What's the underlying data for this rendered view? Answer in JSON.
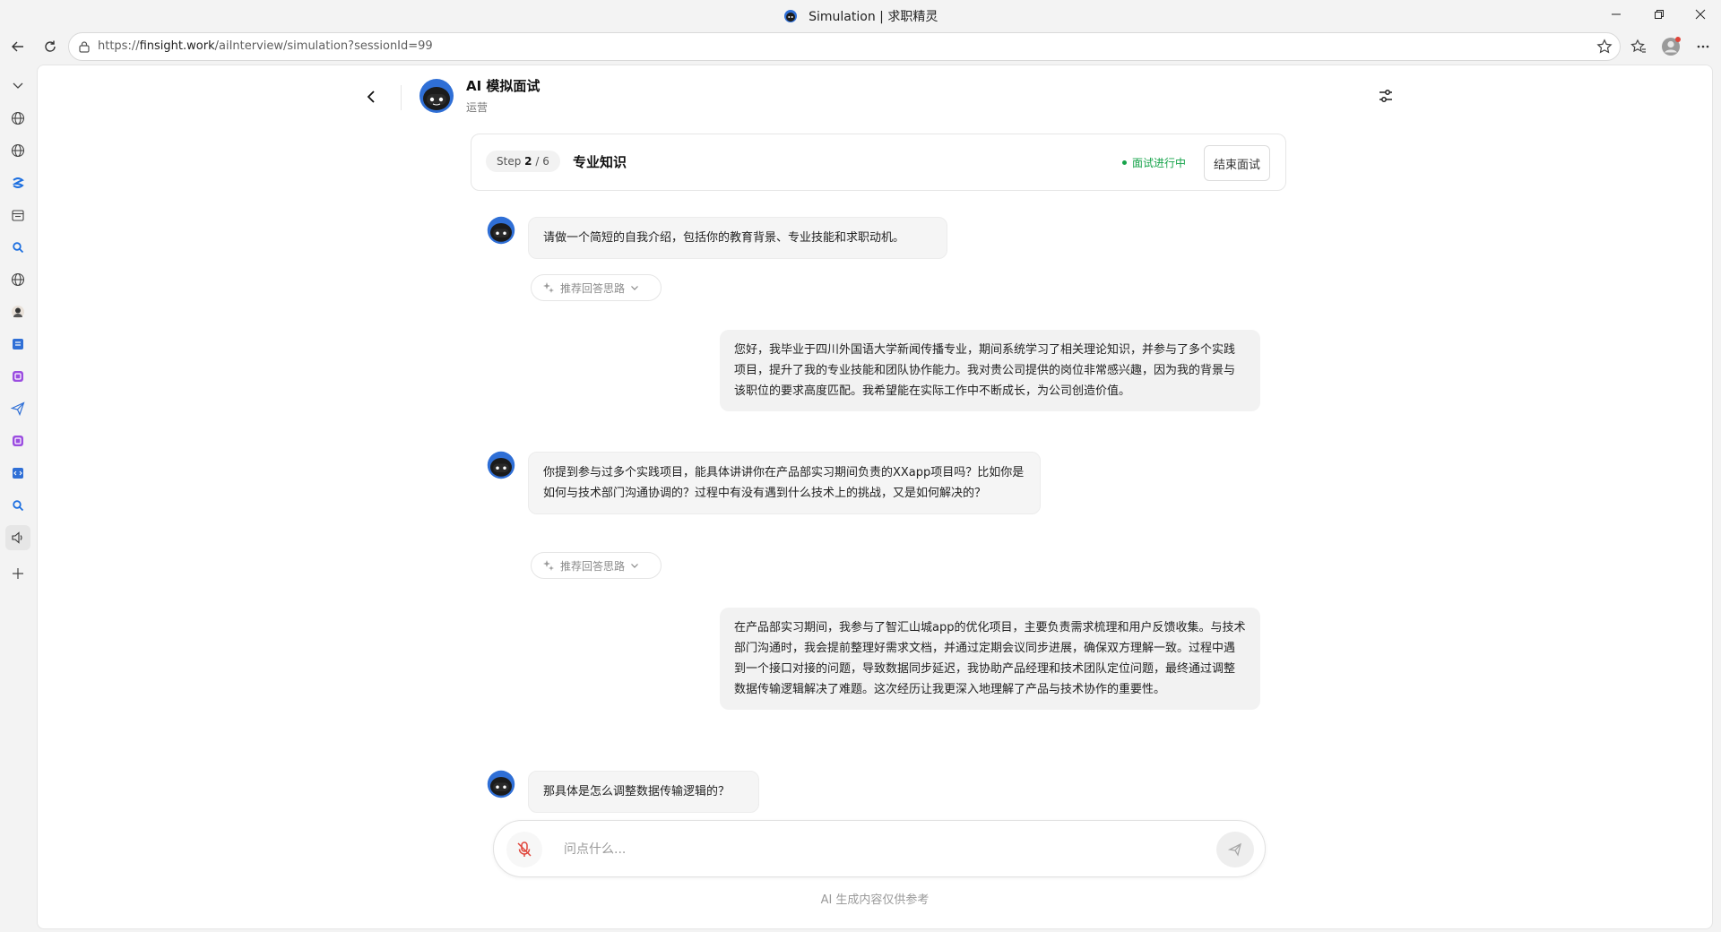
{
  "window": {
    "title": "Simulation | 求职精灵"
  },
  "browser": {
    "url_prefix": "https://",
    "url_host": "finsight.work",
    "url_path": "/aiInterview/simulation?sessionId=99"
  },
  "header": {
    "title": "AI 模拟面试",
    "subtitle": "运营"
  },
  "step": {
    "label": "Step",
    "current": "2",
    "total": "/ 6",
    "name": "专业知识",
    "status": "面试进行中",
    "end_button": "结束面试"
  },
  "messages": [
    {
      "role": "ai",
      "text": "请做一个简短的自我介绍，包括你的教育背景、专业技能和求职动机。",
      "hint": "推荐回答思路"
    },
    {
      "role": "user",
      "text": "您好，我毕业于四川外国语大学新闻传播专业，期间系统学习了相关理论知识，并参与了多个实践项目，提升了我的专业技能和团队协作能力。我对贵公司提供的岗位非常感兴趣，因为我的背景与该职位的要求高度匹配。我希望能在实际工作中不断成长，为公司创造价值。"
    },
    {
      "role": "ai",
      "text": "你提到参与过多个实践项目，能具体讲讲你在产品部实习期间负责的XXapp项目吗？比如你是如何与技术部门沟通协调的？过程中有没有遇到什么技术上的挑战，又是如何解决的？",
      "hint": "推荐回答思路"
    },
    {
      "role": "user",
      "text": "在产品部实习期间，我参与了智汇山城app的优化项目，主要负责需求梳理和用户反馈收集。与技术部门沟通时，我会提前整理好需求文档，并通过定期会议同步进展，确保双方理解一致。过程中遇到一个接口对接的问题，导致数据同步延迟，我协助产品经理和技术团队定位问题，最终通过调整数据传输逻辑解决了难题。这次经历让我更深入地理解了产品与技术协作的重要性。"
    },
    {
      "role": "ai",
      "text": "那具体是怎么调整数据传输逻辑的？"
    }
  ],
  "composer": {
    "placeholder": "问点什么..."
  },
  "footer": {
    "disclaimer": "AI 生成内容仅供参考"
  },
  "colors": {
    "status_green": "#16a34a",
    "mic_red": "#e0453a",
    "robot_blue": "#2f6fd6"
  }
}
